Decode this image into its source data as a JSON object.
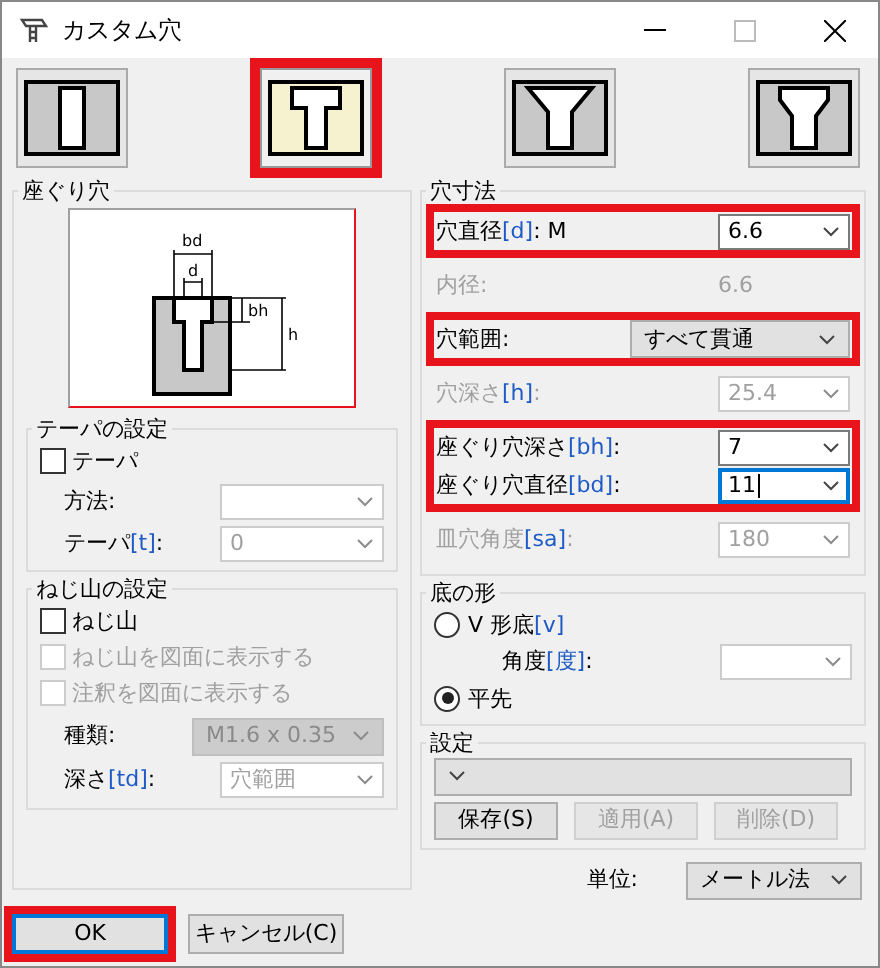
{
  "window": {
    "title": "カスタム穴"
  },
  "hole_types": [
    {
      "kind": "simple",
      "selected": false
    },
    {
      "kind": "counterbore",
      "selected": true
    },
    {
      "kind": "countersink",
      "selected": false
    },
    {
      "kind": "counterdrill",
      "selected": false
    }
  ],
  "preview": {
    "title": "座ぐり穴",
    "labels": [
      "bd",
      "d",
      "bh",
      "h"
    ]
  },
  "taper": {
    "title": "テーパの設定",
    "checkbox": {
      "label": "テーパ",
      "checked": false,
      "disabled": false
    },
    "rows": [
      {
        "label": "方法:",
        "kind": "combo",
        "disabled": true,
        "focused": false
      },
      {
        "label": "テーパ",
        "code": "[t]",
        "suffix": ":",
        "kind": "combo",
        "value": "0",
        "disabled": true,
        "focused": false
      }
    ]
  },
  "thread": {
    "title": "ねじ山の設定",
    "checkboxes": [
      {
        "label": "ねじ山",
        "checked": false,
        "disabled": false
      },
      {
        "label": "ねじ山を図面に表示する",
        "checked": false,
        "disabled": true
      },
      {
        "label": "注釈を図面に表示する",
        "checked": false,
        "disabled": true
      }
    ],
    "rows": [
      {
        "label": "種類:",
        "kind": "dropdown",
        "value": "M1.6 x 0.35",
        "disabled": true
      },
      {
        "label": "深さ",
        "code": "[td]",
        "suffix": ":",
        "kind": "combo",
        "value": "穴範囲",
        "disabled": true,
        "focused": false
      }
    ]
  },
  "dimensions": {
    "title": "穴寸法",
    "groups": [
      {
        "highlighted": true,
        "rows": [
          {
            "label": "穴直径",
            "code": "[d]",
            "suffix": ": M",
            "kind": "combo",
            "value": "6.6",
            "disabled": false,
            "focused": false
          }
        ]
      },
      {
        "highlighted": false,
        "rows": [
          {
            "label": "内径:",
            "kind": "readonly",
            "value": "6.6",
            "disabled": true
          }
        ]
      },
      {
        "highlighted": true,
        "rows": [
          {
            "label": "穴範囲:",
            "kind": "dropdown",
            "value": "すべて貫通",
            "disabled": false
          }
        ]
      },
      {
        "highlighted": false,
        "rows": [
          {
            "label": "穴深さ",
            "code": "[h]",
            "suffix": ":",
            "kind": "combo",
            "value": "25.4",
            "disabled": true,
            "focused": false
          }
        ]
      },
      {
        "highlighted": true,
        "rows": [
          {
            "label": "座ぐり穴深さ",
            "code": "[bh]",
            "suffix": ":",
            "kind": "combo",
            "value": "7",
            "disabled": false,
            "focused": false
          },
          {
            "label": "座ぐり穴直径",
            "code": "[bd]",
            "suffix": ":",
            "kind": "combo",
            "value": "11",
            "disabled": false,
            "focused": true
          }
        ]
      },
      {
        "highlighted": false,
        "rows": [
          {
            "label": "皿穴角度",
            "code": "[sa]",
            "suffix": ":",
            "kind": "combo",
            "value": "180",
            "disabled": true,
            "focused": false
          }
        ]
      }
    ]
  },
  "bottom_shape": {
    "title": "底の形",
    "radios": [
      {
        "label": "V 形底",
        "code": "[v]",
        "selected": false
      },
      {
        "label": "平先",
        "selected": true
      }
    ],
    "angle": {
      "label": "角度",
      "code": "[度]",
      "suffix": ":",
      "kind": "combo",
      "disabled": true,
      "focused": false
    }
  },
  "settings": {
    "title": "設定",
    "buttons": [
      {
        "label": "保存(S)",
        "disabled": false
      },
      {
        "label": "適用(A)",
        "disabled": true
      },
      {
        "label": "削除(D)",
        "disabled": true
      }
    ]
  },
  "unit": {
    "label": "単位:",
    "value": "メートル法"
  },
  "buttons": [
    {
      "label": "OK",
      "default": true,
      "highlighted": true
    },
    {
      "label": "キャンセル(C)",
      "default": false,
      "highlighted": false
    }
  ]
}
